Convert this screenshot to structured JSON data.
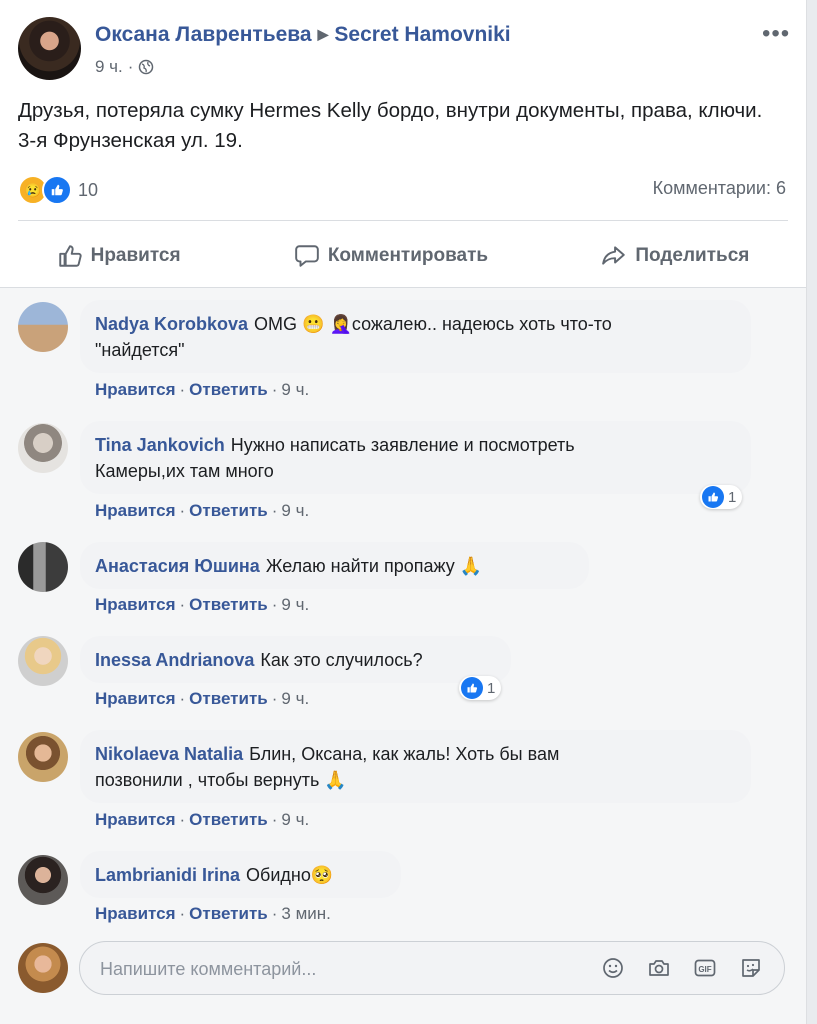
{
  "post": {
    "author": "Оксана Лаврентьева",
    "group": "Secret Hamovniki",
    "time": "9 ч.",
    "dot": "·",
    "more": "•••",
    "text": "Друзья, потеряла сумку Hermes Kelly бордо, внутри документы, права, ключи. 3-я Фрунзенская ул. 19.",
    "reactions_count": "10",
    "comments_count": "Комментарии: 6"
  },
  "actions": {
    "like": "Нравится",
    "comment": "Комментировать",
    "share": "Поделиться"
  },
  "comments": [
    {
      "name": "Nadya Korobkova",
      "text1": "OMG 😬 🤦‍♀️сожалею.. надеюсь хоть что-то",
      "text2": "\"найдется\"",
      "like": "Нравится",
      "reply": "Ответить",
      "time": "9 ч."
    },
    {
      "name": "Tina Jankovich",
      "text1": "Нужно написать заявление и посмотреть",
      "text2": "Камеры,их там много",
      "like": "Нравится",
      "reply": "Ответить",
      "time": "9 ч.",
      "likes": "1"
    },
    {
      "name": "Анастасия Юшина",
      "text1": "Желаю найти пропажу 🙏",
      "like": "Нравится",
      "reply": "Ответить",
      "time": "9 ч."
    },
    {
      "name": "Inessa Andrianova",
      "text1": "Как это случилось?",
      "like": "Нравится",
      "reply": "Ответить",
      "time": "9 ч.",
      "likes": "1"
    },
    {
      "name": "Nikolaeva Natalia",
      "text1": "Блин, Оксана, как жаль! Хоть бы вам",
      "text2": "позвонили , чтобы вернуть 🙏",
      "like": "Нравится",
      "reply": "Ответить",
      "time": "9 ч."
    },
    {
      "name": "Lambrianidi Irina",
      "text1": "Обидно🥺",
      "like": "Нравится",
      "reply": "Ответить",
      "time": "3 мин."
    }
  ],
  "composer": {
    "placeholder": "Напишите комментарий..."
  },
  "icons": {
    "globe": "globe-icon",
    "like": "thumbs-up-icon",
    "comment": "speech-bubble-icon",
    "share": "share-arrow-icon",
    "emoji": "smiley-icon",
    "camera": "camera-icon",
    "gif": "gif-icon",
    "sticker": "sticker-icon"
  },
  "colors": {
    "link": "#385898",
    "like_blue": "#1877f2",
    "muted": "#606770"
  }
}
